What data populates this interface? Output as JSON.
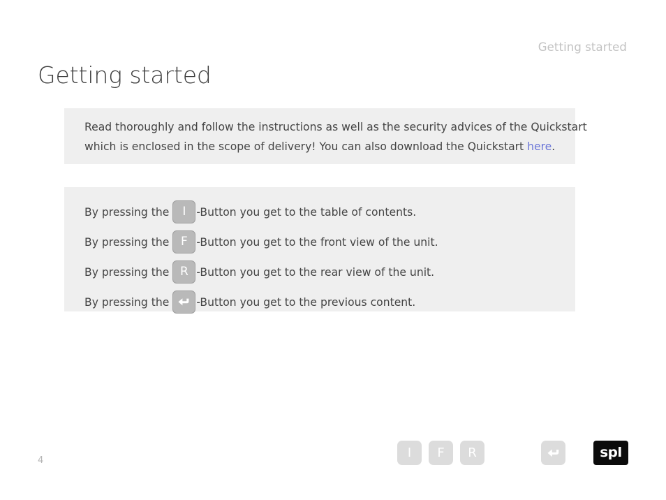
{
  "header": {
    "running_title": "Getting started"
  },
  "title": "Getting started",
  "notice": {
    "line1": "Read thoroughly and follow the instructions as well as the security advices of the Quickstart",
    "line2_before": "which is enclosed in the scope of delivery! You can also download the Quickstart ",
    "link_label": "here",
    "line2_after": ".",
    "link_color": "#6c77d8"
  },
  "key_rows": [
    {
      "text_before": "By pressing the",
      "key_label": "I",
      "key_icon": "letter-i",
      "text_after": "-Button you get to the table of contents."
    },
    {
      "text_before": "By pressing the",
      "key_label": "F",
      "key_icon": "letter-f",
      "text_after": "-Button you get to the front view of the unit."
    },
    {
      "text_before": "By pressing the",
      "key_label": "R",
      "key_icon": "letter-r",
      "text_after": "-Button you get to the rear view of the unit."
    },
    {
      "text_before": "By pressing the",
      "key_label": "",
      "key_icon": "back-arrow-icon",
      "text_after": "-Button you get to the previous content."
    }
  ],
  "footer": {
    "page_number": "4",
    "nav_buttons": [
      {
        "label": "I",
        "icon": "letter-i"
      },
      {
        "label": "F",
        "icon": "letter-f"
      },
      {
        "label": "R",
        "icon": "letter-r"
      }
    ],
    "back_button": {
      "label": "",
      "icon": "back-arrow-icon"
    },
    "logo_text": "spl"
  },
  "colors": {
    "panel_bg": "#efefef",
    "inline_key_bg": "#b9b9b9",
    "footer_key_bg": "#dcdcdc",
    "logo_bg": "#0b0b0b",
    "title_text": "#3c3c3c",
    "body_text": "#444444",
    "muted_text": "#c2c2c2"
  }
}
